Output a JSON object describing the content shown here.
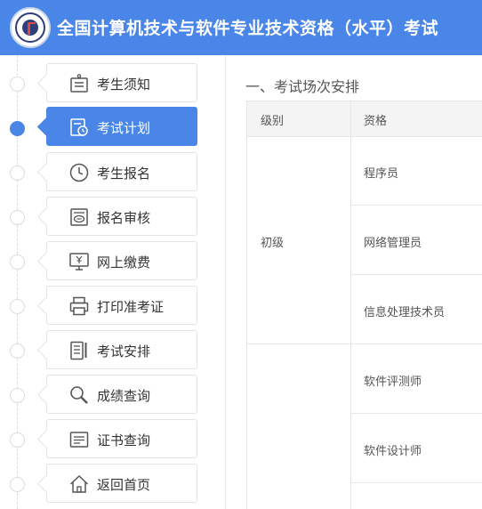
{
  "header": {
    "title": "全国计算机技术与软件专业技术资格（水平）考试",
    "accent_color": "#4a86e8"
  },
  "nav": {
    "items": [
      {
        "label": "考生须知",
        "icon": "notice-icon",
        "active": false
      },
      {
        "label": "考试计划",
        "icon": "schedule-clock-icon",
        "active": true
      },
      {
        "label": "考生报名",
        "icon": "clock-icon",
        "active": false
      },
      {
        "label": "报名审核",
        "icon": "review-icon",
        "active": false
      },
      {
        "label": "网上缴费",
        "icon": "payment-monitor-icon",
        "active": false
      },
      {
        "label": "打印准考证",
        "icon": "printer-icon",
        "active": false
      },
      {
        "label": "考试安排",
        "icon": "arrangement-document-icon",
        "active": false
      },
      {
        "label": "成绩查询",
        "icon": "magnifier-icon",
        "active": false
      },
      {
        "label": "证书查询",
        "icon": "certificate-icon",
        "active": false
      },
      {
        "label": "返回首页",
        "icon": "home-icon",
        "active": false
      }
    ]
  },
  "main": {
    "section_title": "一、考试场次安排",
    "table": {
      "headers": [
        "级别",
        "资格"
      ],
      "groups": [
        {
          "level": "初级",
          "qualifications": [
            "程序员",
            "网络管理员",
            "信息处理技术员"
          ]
        },
        {
          "level": "",
          "qualifications": [
            "软件评测师",
            "软件设计师",
            ""
          ]
        }
      ]
    }
  }
}
